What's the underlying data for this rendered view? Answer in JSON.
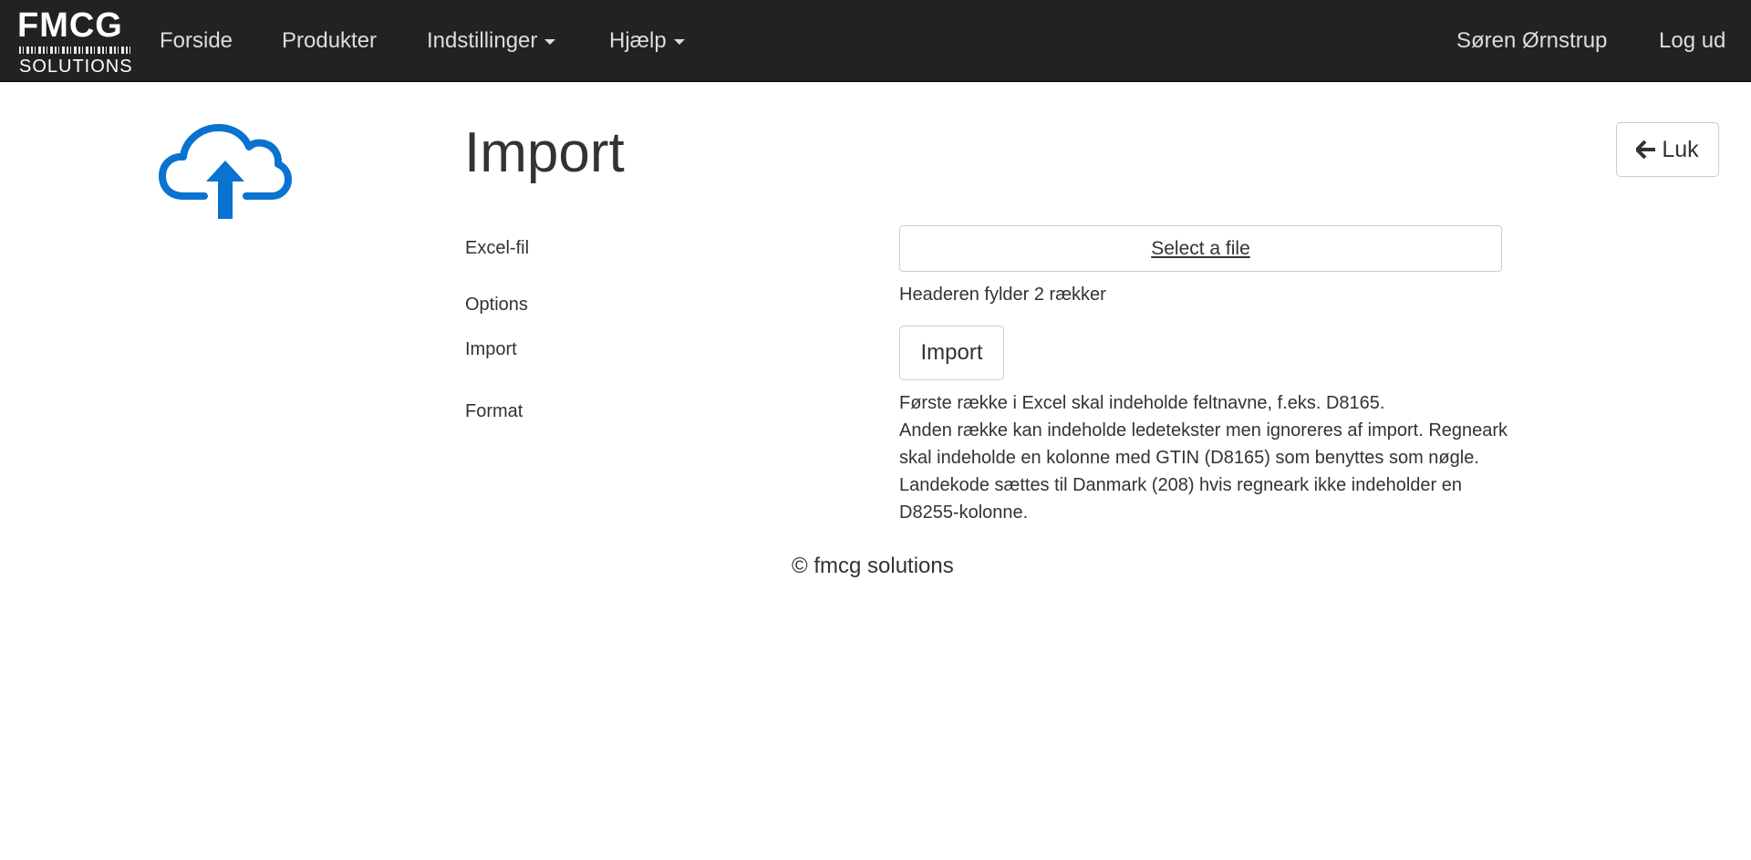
{
  "navbar": {
    "brand": {
      "top": "FMCG",
      "bottom": "SOLUTIONS"
    },
    "items": [
      {
        "label": "Forside"
      },
      {
        "label": "Produkter"
      },
      {
        "label": "Indstillinger"
      },
      {
        "label": "Hjælp"
      }
    ],
    "user_name": "Søren Ørnstrup",
    "logout_label": "Log ud"
  },
  "page": {
    "title": "Import",
    "close_label": "Luk",
    "icon": "cloud-upload-icon",
    "accent_color": "#0a72d1"
  },
  "form": {
    "excel_label": "Excel-fil",
    "file_button": "Select a file",
    "options_label": "Options",
    "options_value": "Headeren fylder 2 rækker",
    "import_label": "Import",
    "import_button": "Import",
    "format_label": "Format",
    "format_lines": [
      "Første række i Excel skal indeholde feltnavne, f.eks. D8165.",
      "Anden række kan indeholde ledetekster men ignoreres af import. Regneark skal indeholde en kolonne med GTIN (D8165) som benyttes som nøgle. Landekode sættes til Danmark (208) hvis regneark ikke indeholder en D8255-kolonne."
    ]
  },
  "footer": {
    "text": "© fmcg solutions"
  }
}
